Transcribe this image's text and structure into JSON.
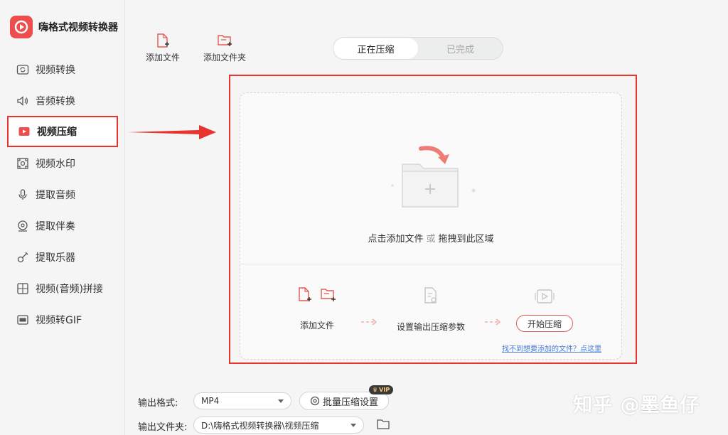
{
  "app": {
    "title": "嗨格式视频转换器",
    "accent_color": "#ee4d4d",
    "highlight_color": "#e8342c"
  },
  "sidebar": {
    "items": [
      {
        "label": "视频转换",
        "icon": "video-convert-icon",
        "active": false
      },
      {
        "label": "音频转换",
        "icon": "audio-convert-icon",
        "active": false
      },
      {
        "label": "视频压缩",
        "icon": "video-compress-icon",
        "active": true
      },
      {
        "label": "视频水印",
        "icon": "video-watermark-icon",
        "active": false
      },
      {
        "label": "提取音频",
        "icon": "extract-audio-icon",
        "active": false
      },
      {
        "label": "提取伴奏",
        "icon": "extract-accompaniment-icon",
        "active": false
      },
      {
        "label": "提取乐器",
        "icon": "extract-instrument-icon",
        "active": false
      },
      {
        "label": "视频(音频)拼接",
        "icon": "merge-icon",
        "active": false
      },
      {
        "label": "视频转GIF",
        "icon": "gif-icon",
        "active": false
      }
    ]
  },
  "toolbar": {
    "add_file": "添加文件",
    "add_folder": "添加文件夹"
  },
  "tabs": {
    "active": "正在压缩",
    "inactive": "已完成"
  },
  "drop_zone": {
    "hint_prefix": "点击添加文件",
    "hint_or": "或",
    "hint_suffix": "拖拽到此区域",
    "step1": "添加文件",
    "step2": "设置输出压缩参数",
    "start_button": "开始压缩",
    "help_link": "找不到想要添加的文件？点这里"
  },
  "bottom": {
    "format_label": "输出格式:",
    "format_value": "MP4",
    "batch_button": "批量压缩设置",
    "vip_badge": "VIP",
    "folder_label": "输出文件夹:",
    "folder_value": "D:\\嗨格式视频转换器\\视频压缩"
  },
  "watermark": "知乎 @墨鱼仔"
}
